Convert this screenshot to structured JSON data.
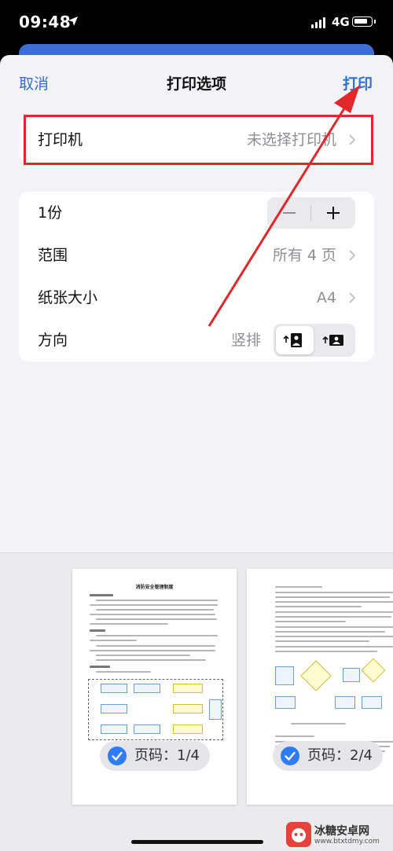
{
  "status_bar": {
    "time": "09:48",
    "network": "4G"
  },
  "nav": {
    "cancel": "取消",
    "title": "打印选项",
    "print": "打印"
  },
  "printer_row": {
    "label": "打印机",
    "value": "未选择打印机"
  },
  "options": {
    "copies": {
      "label": "1份",
      "minus": "—",
      "plus": "+"
    },
    "range": {
      "label": "范围",
      "value": "所有 4 页"
    },
    "paper": {
      "label": "纸张大小",
      "value": "A4"
    },
    "orientation": {
      "label": "方向",
      "value": "竖排"
    }
  },
  "preview": {
    "pages": [
      {
        "badge": "页码：1/4",
        "doc_title": "消防安全管理制度",
        "selected": true
      },
      {
        "badge": "页码：2/4",
        "selected": true
      }
    ]
  },
  "watermark": {
    "name": "冰糖安卓网",
    "url": "www.btxtdmy.com"
  },
  "colors": {
    "accent": "#2f6fd6",
    "highlight": "#e3262a",
    "check": "#2f7cf6"
  }
}
